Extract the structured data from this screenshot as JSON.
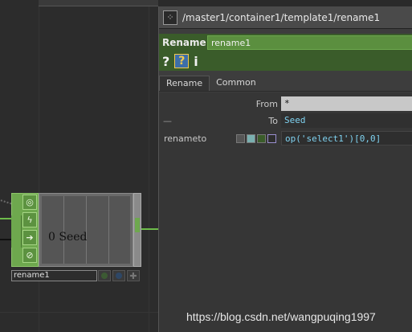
{
  "network": {
    "node": {
      "display_text": "0 Seed",
      "name": "rename1"
    }
  },
  "panel": {
    "path": "/master1/container1/template1/rename1",
    "op_type_label": "Rename",
    "op_name": "rename1",
    "help": {
      "question": "?",
      "python": "?",
      "info": "i"
    },
    "tabs": [
      {
        "label": "Rename"
      },
      {
        "label": "Common"
      }
    ],
    "params": {
      "from": {
        "label": "From",
        "value": "*"
      },
      "to": {
        "label": "To",
        "value": "Seed",
        "toggle": "—"
      },
      "renameto": {
        "label": "renameto",
        "value": "op('select1')[0,0]"
      }
    }
  },
  "watermark": "https://blog.csdn.net/wangpuqing1997",
  "colors": {
    "accent_green": "#6ea84e",
    "panel_green": "#3a5c2a",
    "expr_blue": "#7fd2f0"
  }
}
